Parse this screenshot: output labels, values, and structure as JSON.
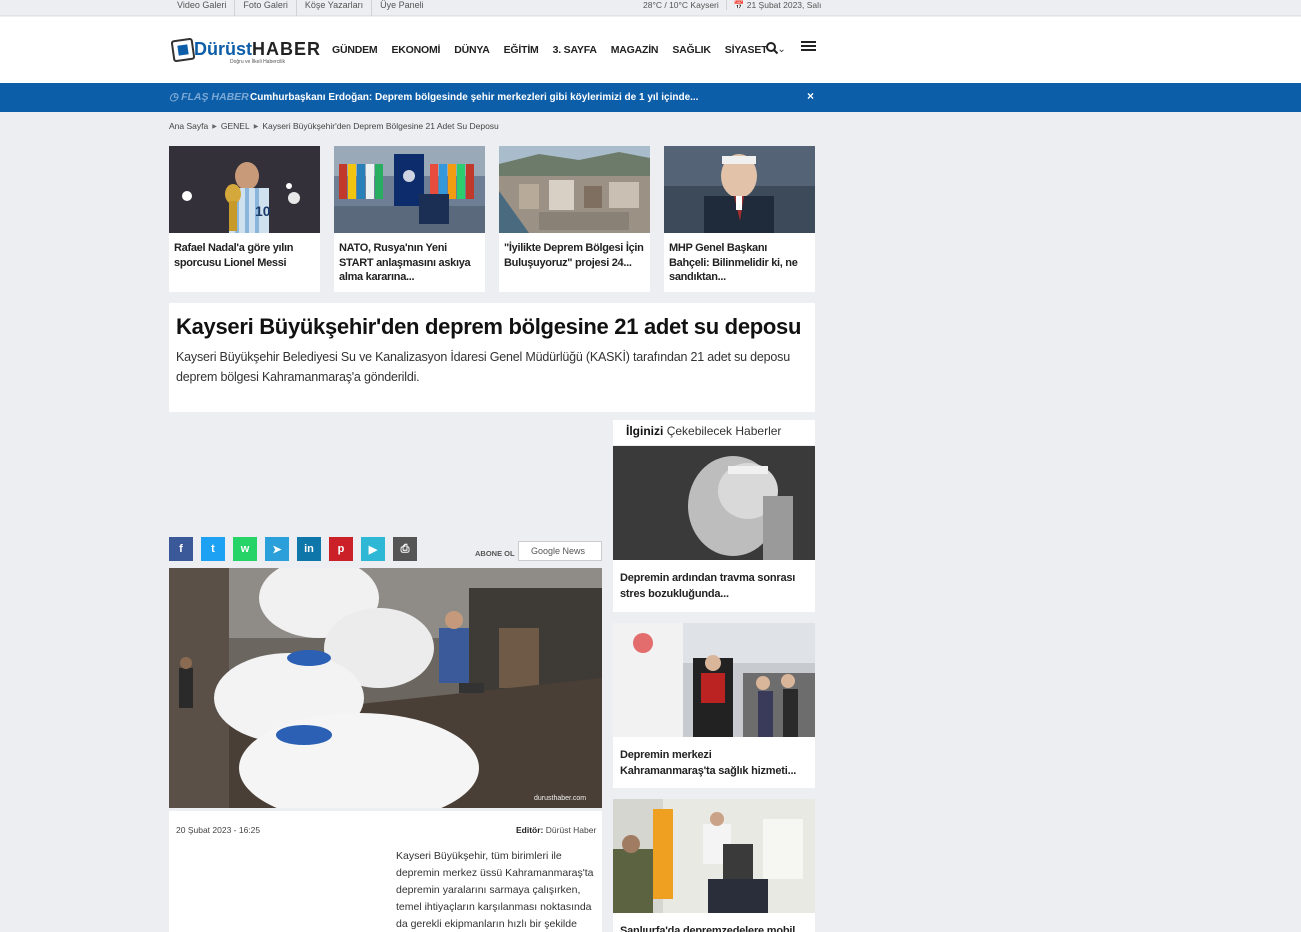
{
  "topbar": {
    "links": [
      "Video Galeri",
      "Foto Galeri",
      "Köşe Yazarları",
      "Üye Paneli"
    ],
    "weather": "28°C / 10°C Kayseri",
    "date": "21 Şubat 2023, Salı"
  },
  "header": {
    "logo_brand_a": "Dürüst",
    "logo_brand_b": "HABER",
    "logo_tagline": "Doğru ve İlkeli Habercilik",
    "nav": [
      "GÜNDEM",
      "EKONOMİ",
      "DÜNYA",
      "EĞİTİM",
      "3. SAYFA",
      "MAGAZİN",
      "SAĞLIK",
      "SİYASET"
    ]
  },
  "flash": {
    "label": "FLAŞ HABER",
    "text": "Cumhurbaşkanı Erdoğan: Deprem bölgesinde şehir merkezleri gibi köylerimizi de 1 yıl içinde...",
    "close": "×"
  },
  "breadcrumb": [
    "Ana Sayfa",
    "GENEL",
    "Kayseri Büyükşehir'den Deprem Bölgesine 21 Adet Su Deposu"
  ],
  "cards": [
    {
      "title": "Rafael Nadal'a göre yılın sporcusu Lionel Messi"
    },
    {
      "title": "NATO, Rusya'nın Yeni START anlaşmasını askıya alma kararına..."
    },
    {
      "title": "\"İyilikte Deprem Bölgesi İçin Buluşuyoruz\" projesi 24..."
    },
    {
      "title": "MHP Genel Başkanı Bahçeli: Bilinmelidir ki, ne sandıktan..."
    }
  ],
  "article": {
    "title": "Kayseri Büyükşehir'den deprem bölgesine 21 adet su deposu",
    "summary": "Kayseri Büyükşehir Belediyesi Su ve Kanalizasyon İdaresi Genel Müdürlüğü (KASKİ) tarafından 21 adet su deposu deprem bölgesi Kahramanmaraş'a gönderildi.",
    "date": "20 Şubat 2023 - 16:25",
    "editor_label": "Editör:",
    "editor_name": "Dürüst Haber",
    "body": "Kayseri Büyükşehir, tüm birimleri ile depremin merkez üssü Kahramanmaraş'ta depremin yaralarını sarmaya çalışırken, temel ihtiyaçların karşılanması noktasında da gerekli ekipmanların hızlı bir şekilde",
    "watermark": "durusthaber.com"
  },
  "share": {
    "abone_label": "ABONE OL",
    "gnews_label": "Google News",
    "buttons": [
      {
        "icon": "facebook-icon",
        "glyph": "f",
        "color": "#3b5998"
      },
      {
        "icon": "twitter-icon",
        "glyph": "t",
        "color": "#1da1f2"
      },
      {
        "icon": "whatsapp-icon",
        "glyph": "w",
        "color": "#25d366"
      },
      {
        "icon": "telegram-icon",
        "glyph": "➤",
        "color": "#2a9fd9"
      },
      {
        "icon": "linkedin-icon",
        "glyph": "in",
        "color": "#0e76a8"
      },
      {
        "icon": "pinterest-icon",
        "glyph": "p",
        "color": "#cb2027"
      },
      {
        "icon": "flipboard-icon",
        "glyph": "▶",
        "color": "#2fb8d6"
      },
      {
        "icon": "print-icon",
        "glyph": "⎙",
        "color": "#555555"
      }
    ]
  },
  "sidebar": {
    "heading_bold": "İlginizi",
    "heading_rest": "Çekebilecek Haberler",
    "items": [
      {
        "title": "Depremin ardından travma sonrası stres bozukluğunda..."
      },
      {
        "title": "Depremin merkezi Kahramanmaraş'ta sağlık hizmeti..."
      },
      {
        "title": "Şanlıurfa'da depremzedelere mobil"
      }
    ]
  },
  "colors": {
    "accent": "#0d5ea8",
    "background": "#eceef1"
  }
}
